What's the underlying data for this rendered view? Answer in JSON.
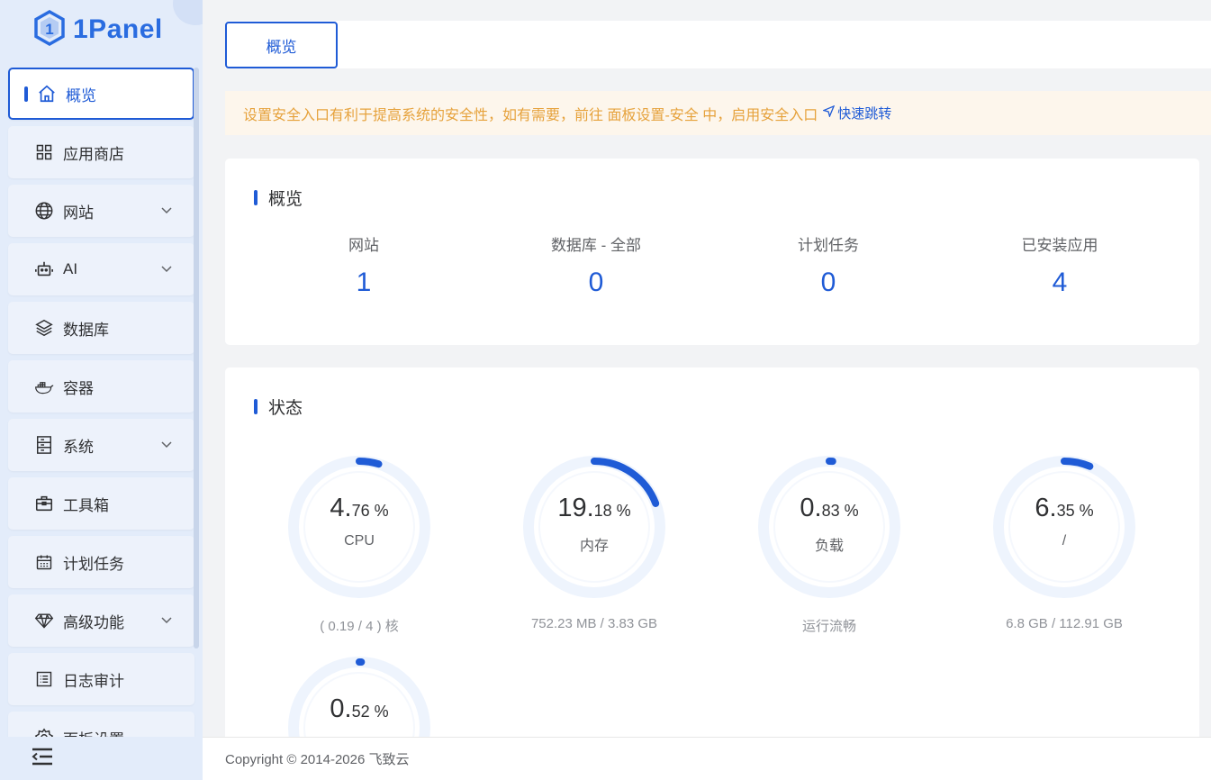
{
  "app": {
    "logo_text": "1Panel"
  },
  "sidebar": {
    "items": [
      {
        "label": "概览",
        "icon": "home-icon",
        "active": true
      },
      {
        "label": "应用商店",
        "icon": "grid-icon"
      },
      {
        "label": "网站",
        "icon": "globe-icon",
        "expandable": true
      },
      {
        "label": "AI",
        "icon": "robot-icon",
        "expandable": true
      },
      {
        "label": "数据库",
        "icon": "layers-icon"
      },
      {
        "label": "容器",
        "icon": "docker-icon"
      },
      {
        "label": "系统",
        "icon": "server-icon",
        "expandable": true
      },
      {
        "label": "工具箱",
        "icon": "toolbox-icon"
      },
      {
        "label": "计划任务",
        "icon": "calendar-icon"
      },
      {
        "label": "高级功能",
        "icon": "diamond-icon",
        "expandable": true
      },
      {
        "label": "日志审计",
        "icon": "log-icon"
      },
      {
        "label": "面板设置",
        "icon": "gear-icon"
      }
    ]
  },
  "tabs": [
    {
      "label": "概览"
    }
  ],
  "alert": {
    "text": "设置安全入口有利于提高系统的安全性，如有需要，前往 面板设置-安全 中，启用安全入口",
    "link": "快速跳转"
  },
  "overview": {
    "title": "概览",
    "items": [
      {
        "label": "网站",
        "value": "1"
      },
      {
        "label": "数据库 - 全部",
        "value": "0"
      },
      {
        "label": "计划任务",
        "value": "0"
      },
      {
        "label": "已安装应用",
        "value": "4"
      }
    ]
  },
  "status": {
    "title": "状态",
    "gauges": [
      {
        "int": "4.",
        "dec": "76 %",
        "name": "CPU",
        "detail": "( 0.19 / 4 ) 核",
        "percent": 4.76
      },
      {
        "int": "19.",
        "dec": "18 %",
        "name": "内存",
        "detail": "752.23 MB / 3.83 GB",
        "percent": 19.18
      },
      {
        "int": "0.",
        "dec": "83 %",
        "name": "负载",
        "detail": "运行流畅",
        "percent": 0.83
      },
      {
        "int": "6.",
        "dec": "35 %",
        "name": "/",
        "detail": "6.8 GB / 112.91 GB",
        "percent": 6.35
      },
      {
        "int": "0.",
        "dec": "52 %",
        "name": "",
        "detail": "",
        "percent": 0.52
      }
    ]
  },
  "footer": {
    "copyright": "Copyright © 2014-2026 飞致云"
  },
  "colors": {
    "primary": "#1f5bd6",
    "warning": "#e6a23c",
    "track": "#eef4fd"
  }
}
